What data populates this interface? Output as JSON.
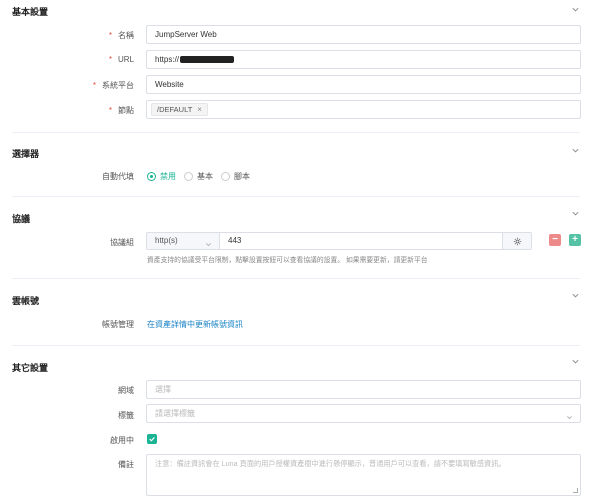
{
  "sections": {
    "basic": "基本設置",
    "selector": "選擇器",
    "protocol": "協議",
    "cloud": "雲帳號",
    "other": "其它設置"
  },
  "required_mark": "*",
  "basic": {
    "name_label": "名稱",
    "name_value": "JumpServer Web",
    "url_label": "URL",
    "url_value": "https://",
    "platform_label": "系統平台",
    "platform_value": "Website",
    "node_label": "節點",
    "node_tag": "/DEFAULT",
    "node_tag_remove": "×"
  },
  "selector": {
    "autofill_label": "自動代填",
    "options": [
      "禁用",
      "基本",
      "腳本"
    ],
    "selected": "禁用"
  },
  "protocol": {
    "group_label": "協議組",
    "protocol_value": "http(s)",
    "port_value": "443",
    "minus": "−",
    "plus": "+",
    "hint": "資產支持的協議受平台限制，點擊設置按鈕可以查看協議的設置。 如果需要更新，請更新平台"
  },
  "cloud": {
    "account_label": "帳號管理",
    "account_link": "在資產詳情中更新帳號資訊"
  },
  "other": {
    "domain_label": "網域",
    "domain_placeholder": "選擇",
    "labels_label": "標籤",
    "labels_placeholder": "請選擇標籤",
    "active_label": "啟用中",
    "active_checked": true,
    "comment_label": "備註",
    "comment_placeholder": "注意：備註資訊會在 Luna 頁面的用戶授權資產樹中進行懸停顯示，普通用戶可以查看，請不要填寫敏感資訊。"
  },
  "colors": {
    "accent": "#1ab394",
    "link": "#1c84c6",
    "danger": "#ed8a8a",
    "success": "#55c2a5",
    "required": "#e0513a"
  }
}
